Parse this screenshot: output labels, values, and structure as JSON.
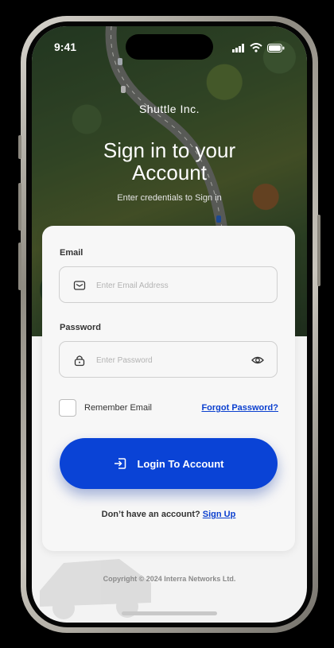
{
  "status_bar": {
    "time": "9:41"
  },
  "brand": "Shuttle Inc.",
  "title_line1": "Sign in to your",
  "title_line2": "Account",
  "subtitle": "Enter credentials to Sign in",
  "form": {
    "email_label": "Email",
    "email_placeholder": "Enter Email Address",
    "password_label": "Password",
    "password_placeholder": "Enter Password",
    "remember_label": "Remember Email",
    "forgot_label": "Forgot Password?",
    "login_label": "Login To Account",
    "signup_prompt": "Don’t have an account?",
    "signup_link": "Sign Up"
  },
  "footer": "Copyright © 2024 Interra Networks Ltd.",
  "colors": {
    "accent": "#0a43d6",
    "link": "#0a3fcf",
    "background": "#f3f3f3"
  },
  "icons": [
    "signal-icon",
    "wifi-icon",
    "battery-icon",
    "email-icon",
    "lock-icon",
    "eye-icon",
    "login-icon"
  ]
}
